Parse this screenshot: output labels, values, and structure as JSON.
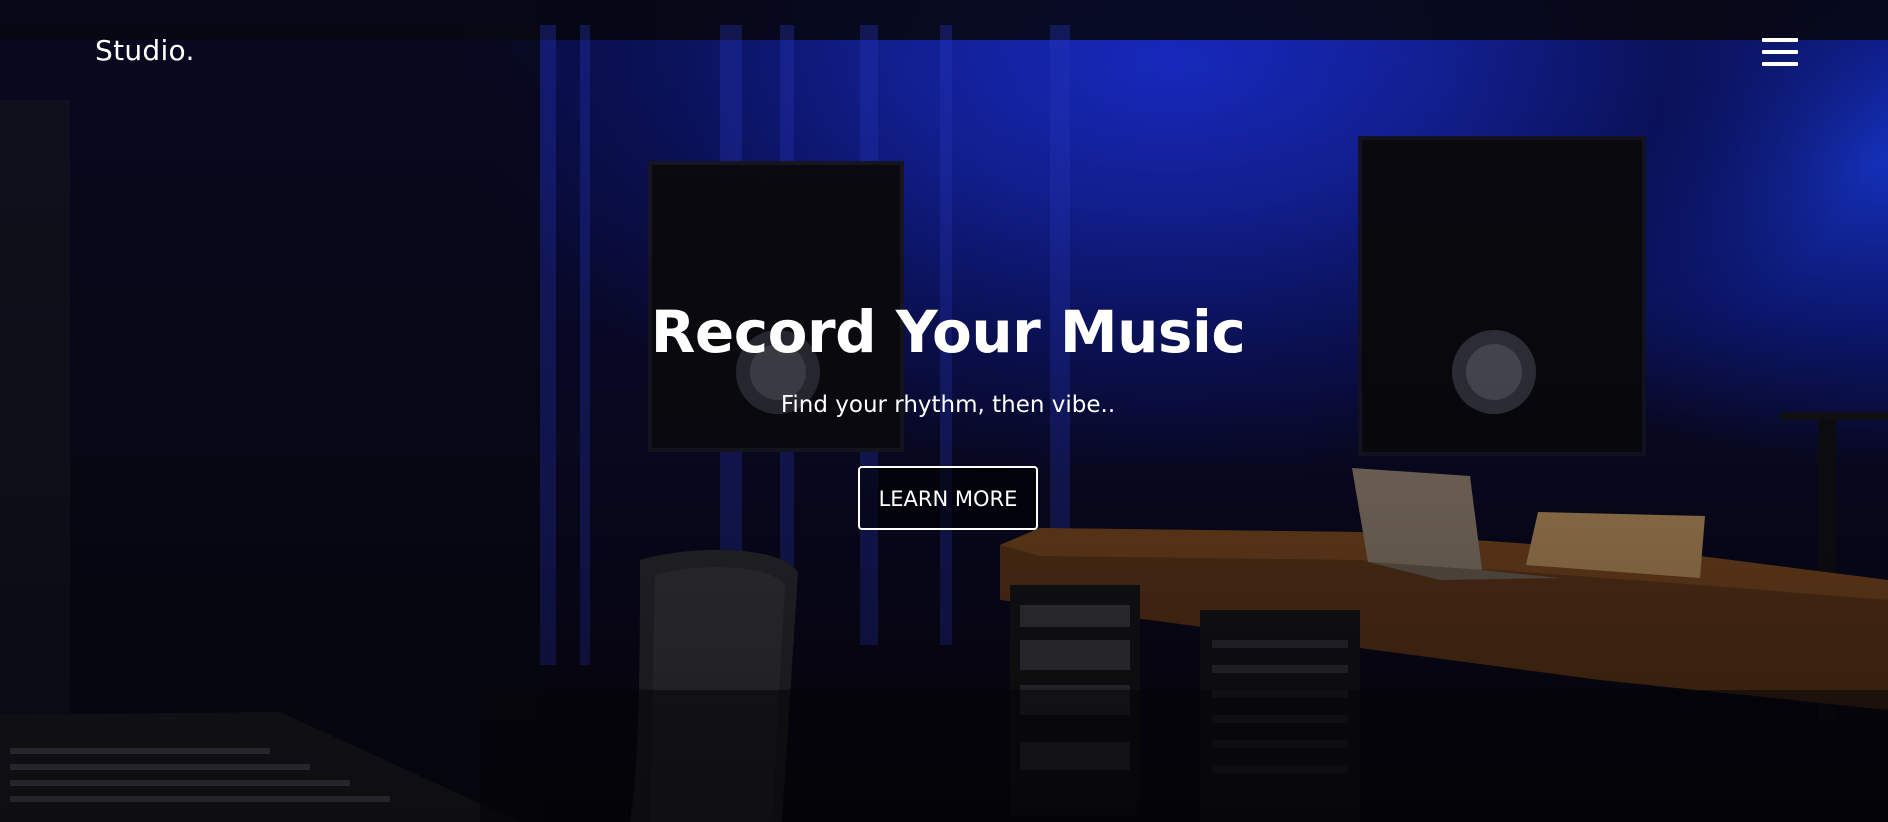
{
  "header": {
    "logo": "Studio.",
    "menu_icon": "hamburger-menu-icon"
  },
  "hero": {
    "title": "Record Your Music",
    "subtitle": "Find your rhythm, then vibe..",
    "cta_label": "LEARN MORE",
    "background_image": "recording-studio-photo"
  },
  "colors": {
    "text": "#ffffff",
    "background_blue": "#1424a8",
    "background_dark": "#0a0710"
  }
}
